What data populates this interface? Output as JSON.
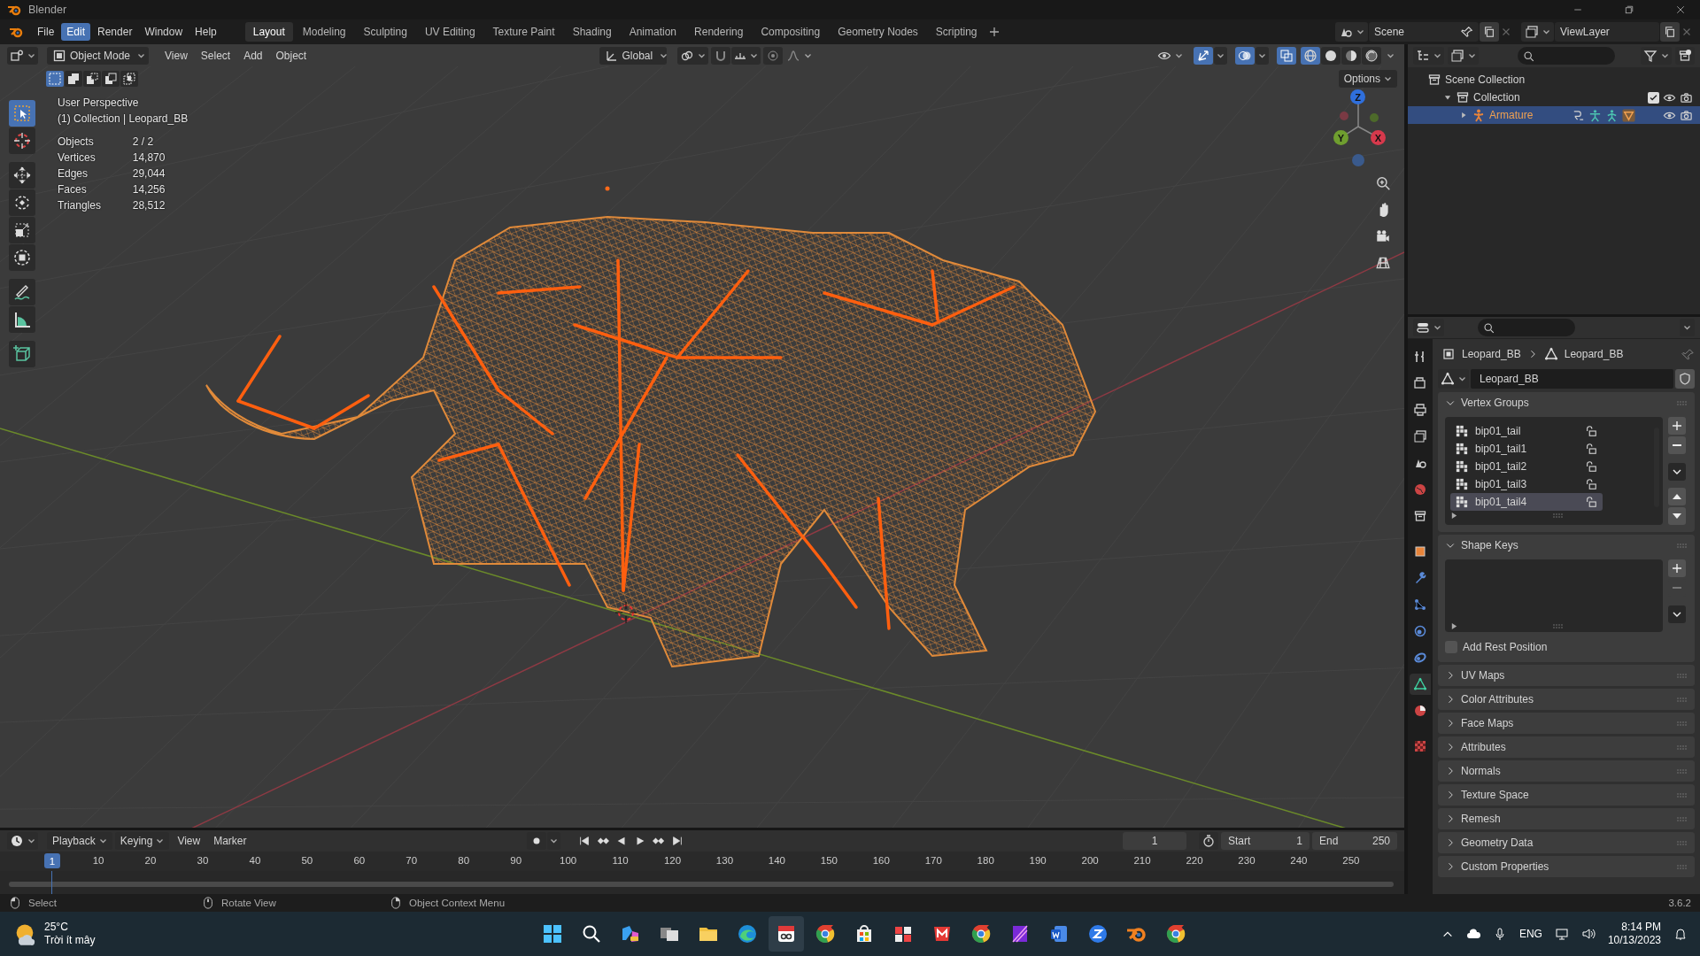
{
  "window": {
    "title": "Blender"
  },
  "menu": [
    {
      "label": "File",
      "selected": false
    },
    {
      "label": "Edit",
      "selected": true
    },
    {
      "label": "Render",
      "selected": false
    },
    {
      "label": "Window",
      "selected": false
    },
    {
      "label": "Help",
      "selected": false
    }
  ],
  "workspaces": [
    {
      "label": "Layout",
      "selected": true
    },
    {
      "label": "Modeling",
      "selected": false
    },
    {
      "label": "Sculpting",
      "selected": false
    },
    {
      "label": "UV Editing",
      "selected": false
    },
    {
      "label": "Texture Paint",
      "selected": false
    },
    {
      "label": "Shading",
      "selected": false
    },
    {
      "label": "Animation",
      "selected": false
    },
    {
      "label": "Rendering",
      "selected": false
    },
    {
      "label": "Compositing",
      "selected": false
    },
    {
      "label": "Geometry Nodes",
      "selected": false
    },
    {
      "label": "Scripting",
      "selected": false
    }
  ],
  "scene": {
    "name": "Scene"
  },
  "view_layer": {
    "name": "ViewLayer"
  },
  "viewport": {
    "mode": "Object Mode",
    "menus": [
      "View",
      "Select",
      "Add",
      "Object"
    ],
    "orientation": "Global",
    "options": "Options",
    "shading": [
      {
        "kind": "wireframe",
        "selected": true
      },
      {
        "kind": "solid",
        "selected": false
      },
      {
        "kind": "material",
        "selected": false
      },
      {
        "kind": "rendered",
        "selected": false
      }
    ],
    "select_modes": [
      {
        "kind": "set",
        "selected": true
      },
      {
        "kind": "extend",
        "selected": false
      },
      {
        "kind": "subtract",
        "selected": false
      },
      {
        "kind": "invert",
        "selected": false
      },
      {
        "kind": "intersect",
        "selected": false
      }
    ],
    "tools": [
      {
        "kind": "select",
        "selected": true
      },
      {
        "kind": "cursor",
        "selected": false
      },
      {
        "kind": "move",
        "selected": false
      },
      {
        "kind": "rotate",
        "selected": false
      },
      {
        "kind": "scale",
        "selected": false
      },
      {
        "kind": "transform",
        "selected": false
      },
      {
        "kind": "annotate",
        "selected": false
      },
      {
        "kind": "measure",
        "selected": false
      },
      {
        "kind": "add_cube",
        "selected": false
      }
    ],
    "info": {
      "view": "User Perspective",
      "object": "(1) Collection | Leopard_BB",
      "stats": [
        {
          "label": "Objects",
          "value": "2 / 2"
        },
        {
          "label": "Vertices",
          "value": "14,870"
        },
        {
          "label": "Edges",
          "value": "29,044"
        },
        {
          "label": "Faces",
          "value": "14,256"
        },
        {
          "label": "Triangles",
          "value": "28,512"
        }
      ]
    },
    "gizmo_axes": [
      {
        "label": "Z",
        "color": "#2f6fdc"
      },
      {
        "label": "Y",
        "color": "#6f9e2f"
      },
      {
        "label": "X",
        "color": "#d6394c"
      }
    ]
  },
  "outliner": {
    "items": [
      {
        "kind": "scene_collection",
        "label": "Scene Collection",
        "selected": false,
        "children": [
          {
            "kind": "collection",
            "label": "Collection",
            "selected": false,
            "expanded": true,
            "checked": true,
            "children": [
              {
                "kind": "armature",
                "label": "Armature",
                "selected": true,
                "expanded": false
              }
            ]
          }
        ]
      }
    ]
  },
  "properties": {
    "tabs": [
      {
        "kind": "tool",
        "selected": false
      },
      {
        "kind": "render",
        "selected": false
      },
      {
        "kind": "output",
        "selected": false
      },
      {
        "kind": "view_layer",
        "selected": false
      },
      {
        "kind": "scene",
        "selected": false
      },
      {
        "kind": "world",
        "selected": false
      },
      {
        "kind": "collection",
        "selected": false
      },
      {
        "kind": "object",
        "selected": false
      },
      {
        "kind": "modifiers",
        "selected": false
      },
      {
        "kind": "particles",
        "selected": false
      },
      {
        "kind": "physics",
        "selected": false
      },
      {
        "kind": "constraints",
        "selected": false
      },
      {
        "kind": "data",
        "selected": true
      },
      {
        "kind": "material",
        "selected": false
      },
      {
        "kind": "texture",
        "selected": false
      }
    ],
    "breadcrumb": [
      "Leopard_BB",
      "Leopard_BB"
    ],
    "mesh": "Leopard_BB",
    "panels": [
      {
        "kind": "vertex_groups",
        "title": "Vertex Groups",
        "expanded": true,
        "items": [
          {
            "label": "bip01_tail",
            "selected": false
          },
          {
            "label": "bip01_tail1",
            "selected": false
          },
          {
            "label": "bip01_tail2",
            "selected": false
          },
          {
            "label": "bip01_tail3",
            "selected": false
          },
          {
            "label": "bip01_tail4",
            "selected": true
          }
        ]
      },
      {
        "kind": "shape_keys",
        "title": "Shape Keys",
        "expanded": true,
        "option": {
          "label": "Add Rest Position",
          "checked": false
        }
      },
      {
        "kind": "plain",
        "title": "UV Maps",
        "expanded": false
      },
      {
        "kind": "plain",
        "title": "Color Attributes",
        "expanded": false
      },
      {
        "kind": "plain",
        "title": "Face Maps",
        "expanded": false
      },
      {
        "kind": "plain",
        "title": "Attributes",
        "expanded": false
      },
      {
        "kind": "plain",
        "title": "Normals",
        "expanded": false
      },
      {
        "kind": "plain",
        "title": "Texture Space",
        "expanded": false
      },
      {
        "kind": "plain",
        "title": "Remesh",
        "expanded": false
      },
      {
        "kind": "plain",
        "title": "Geometry Data",
        "expanded": false
      },
      {
        "kind": "plain",
        "title": "Custom Properties",
        "expanded": false
      }
    ]
  },
  "timeline": {
    "menus": [
      {
        "label": "Playback",
        "kind": "dropdown"
      },
      {
        "label": "Keying",
        "kind": "dropdown"
      },
      {
        "label": "View",
        "kind": "plain"
      },
      {
        "label": "Marker",
        "kind": "plain"
      }
    ],
    "current_frame": "1",
    "marker": "1",
    "start_label": "Start",
    "start": "1",
    "end_label": "End",
    "end": "250",
    "ruler": [
      "10",
      "20",
      "30",
      "40",
      "50",
      "60",
      "70",
      "80",
      "90",
      "100",
      "110",
      "120",
      "130",
      "140",
      "150",
      "160",
      "170",
      "180",
      "190",
      "200",
      "210",
      "220",
      "230",
      "240",
      "250"
    ]
  },
  "status_bar": {
    "hints": [
      {
        "kind": "left",
        "label": "Select"
      },
      {
        "kind": "middle",
        "label": "Rotate View"
      },
      {
        "kind": "right",
        "label": "Object Context Menu"
      }
    ],
    "version": "3.6.2"
  },
  "taskbar": {
    "temperature": "25°C",
    "weather": "Trời ít mây",
    "apps": [
      {
        "kind": "start",
        "selected": false
      },
      {
        "kind": "search",
        "selected": false
      },
      {
        "kind": "copilot",
        "selected": false
      },
      {
        "kind": "task_view",
        "selected": false
      },
      {
        "kind": "folder",
        "selected": false
      },
      {
        "kind": "edge",
        "selected": false
      },
      {
        "kind": "snipping",
        "selected": true
      },
      {
        "kind": "chrome",
        "selected": false
      },
      {
        "kind": "store",
        "selected": false
      },
      {
        "kind": "cards",
        "selected": false
      },
      {
        "kind": "red_app",
        "selected": false
      },
      {
        "kind": "chrome",
        "selected": false
      },
      {
        "kind": "purple_app",
        "selected": false
      },
      {
        "kind": "word",
        "selected": false
      },
      {
        "kind": "chat",
        "selected": false
      },
      {
        "kind": "blender",
        "selected": false
      },
      {
        "kind": "chrome",
        "selected": false
      }
    ],
    "language": "ENG",
    "time": "8:14 PM",
    "date": "10/13/2023"
  }
}
